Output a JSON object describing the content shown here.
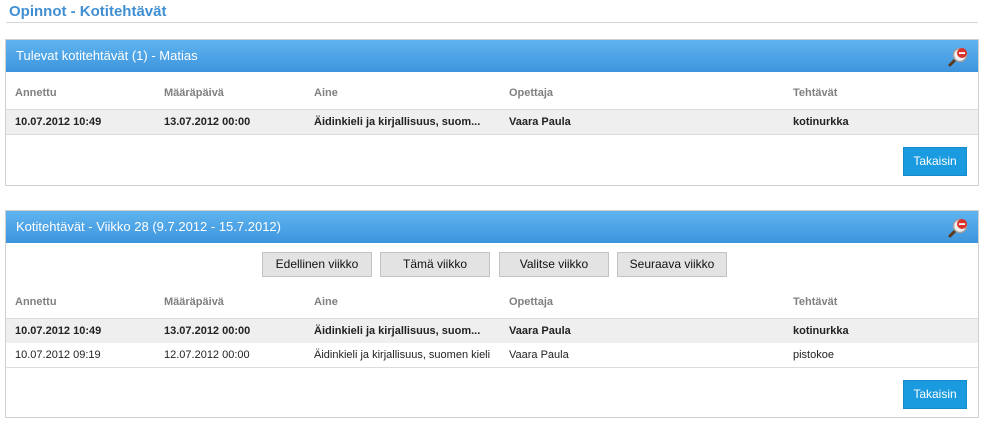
{
  "page": {
    "title": "Opinnot - Kotitehtävät"
  },
  "columns": [
    "Annettu",
    "Määräpäivä",
    "Aine",
    "Opettaja",
    "Tehtävät"
  ],
  "upcoming": {
    "title": "Tulevat kotitehtävät (1) - Matias",
    "rows": [
      {
        "given": "10.07.2012 10:49",
        "due": "13.07.2012 00:00",
        "subject": "Äidinkieli ja kirjallisuus, suom...",
        "teacher": "Vaara Paula",
        "task": "kotinurkka",
        "bold": true
      }
    ],
    "back_label": "Takaisin"
  },
  "week": {
    "title": "Kotitehtävät - Viikko 28 (9.7.2012 - 15.7.2012)",
    "nav": {
      "prev": "Edellinen viikko",
      "this": "Tämä viikko",
      "choose": "Valitse viikko",
      "next": "Seuraava viikko"
    },
    "rows": [
      {
        "given": "10.07.2012 10:49",
        "due": "13.07.2012 00:00",
        "subject": "Äidinkieli ja kirjallisuus, suom...",
        "teacher": "Vaara Paula",
        "task": "kotinurkka",
        "bold": true
      },
      {
        "given": "10.07.2012 09:19",
        "due": "12.07.2012 00:00",
        "subject": "Äidinkieli ja kirjallisuus, suomen kieli",
        "teacher": "Vaara Paula",
        "task": "pistokoe",
        "bold": false
      }
    ],
    "back_label": "Takaisin"
  },
  "icons": {
    "header_icon": "magnifier-remove-icon"
  },
  "colors": {
    "title": "#3f8fd2",
    "header": "#4aa3e6",
    "button": "#1a9be0"
  }
}
